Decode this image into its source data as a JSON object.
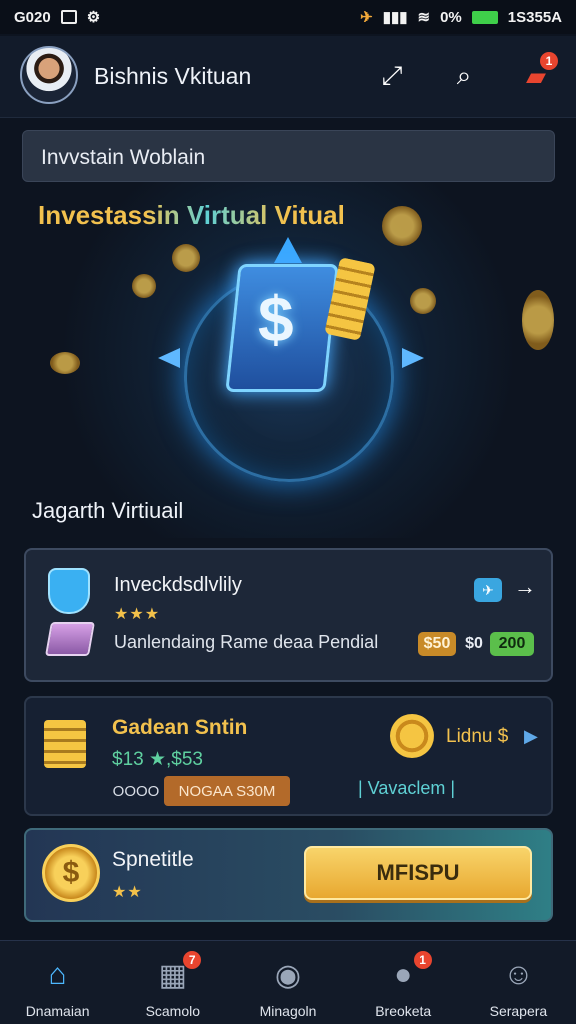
{
  "status": {
    "time": "G020",
    "battery_text": "0%",
    "right_text": "1S355A"
  },
  "header": {
    "username": "Bishnis Vkituan",
    "notification_count": "1"
  },
  "search": {
    "text": "Invvstain Woblain"
  },
  "hero": {
    "title": "Investassin Virtual Vitual",
    "subtitle": "Jagarth Virtiuail"
  },
  "card1": {
    "title": "Inveckdsdlvlily",
    "stars": "★★★",
    "description": "Uanlendaing Rame deaa Pendial",
    "pill_gold": "$50",
    "pill_text": "$0",
    "pill_green": "200"
  },
  "card2": {
    "title": "Gadean Sntin",
    "value": "$13 ★,$53",
    "tag1": "OOOO",
    "tag2": "NOGAA S30M",
    "link": "Lidnu $",
    "vac": "| Vavaclem |"
  },
  "card3": {
    "title": "Spnetitle",
    "stars": "★★",
    "button_label": "MFISPU"
  },
  "nav": [
    {
      "label": "Dnamaian",
      "icon": "home-icon"
    },
    {
      "label": "Scamolo",
      "icon": "cards-icon",
      "badge": "7"
    },
    {
      "label": "Minagoln",
      "icon": "compass-icon"
    },
    {
      "label": "Breoketa",
      "icon": "chat-icon",
      "badge": "1"
    },
    {
      "label": "Serapera",
      "icon": "profile-icon"
    }
  ],
  "colors": {
    "accent_gold": "#f2c14e",
    "accent_blue": "#4db8ff",
    "badge_red": "#e8452f"
  }
}
